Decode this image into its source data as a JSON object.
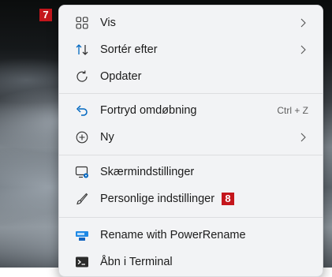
{
  "badges": {
    "top": "7",
    "inline": "8"
  },
  "menu": {
    "items": [
      {
        "label": "Vis",
        "has_submenu": true,
        "icon": "grid-icon"
      },
      {
        "label": "Sortér efter",
        "has_submenu": true,
        "icon": "sort-icon"
      },
      {
        "label": "Opdater",
        "icon": "refresh-icon"
      },
      {
        "label": "Fortryd omdøbning",
        "shortcut": "Ctrl + Z",
        "icon": "undo-icon"
      },
      {
        "label": "Ny",
        "has_submenu": true,
        "icon": "add-circle-icon"
      },
      {
        "label": "Skærmindstillinger",
        "icon": "display-settings-icon"
      },
      {
        "label": "Personlige indstillinger",
        "icon": "brush-icon"
      },
      {
        "label": "Rename with PowerRename",
        "icon": "powerrename-icon"
      },
      {
        "label": "Åbn i Terminal",
        "icon": "terminal-icon"
      }
    ]
  },
  "colors": {
    "accent": "#0067c0",
    "badge": "#c4161c",
    "menu_bg": "#f2f3f5"
  }
}
